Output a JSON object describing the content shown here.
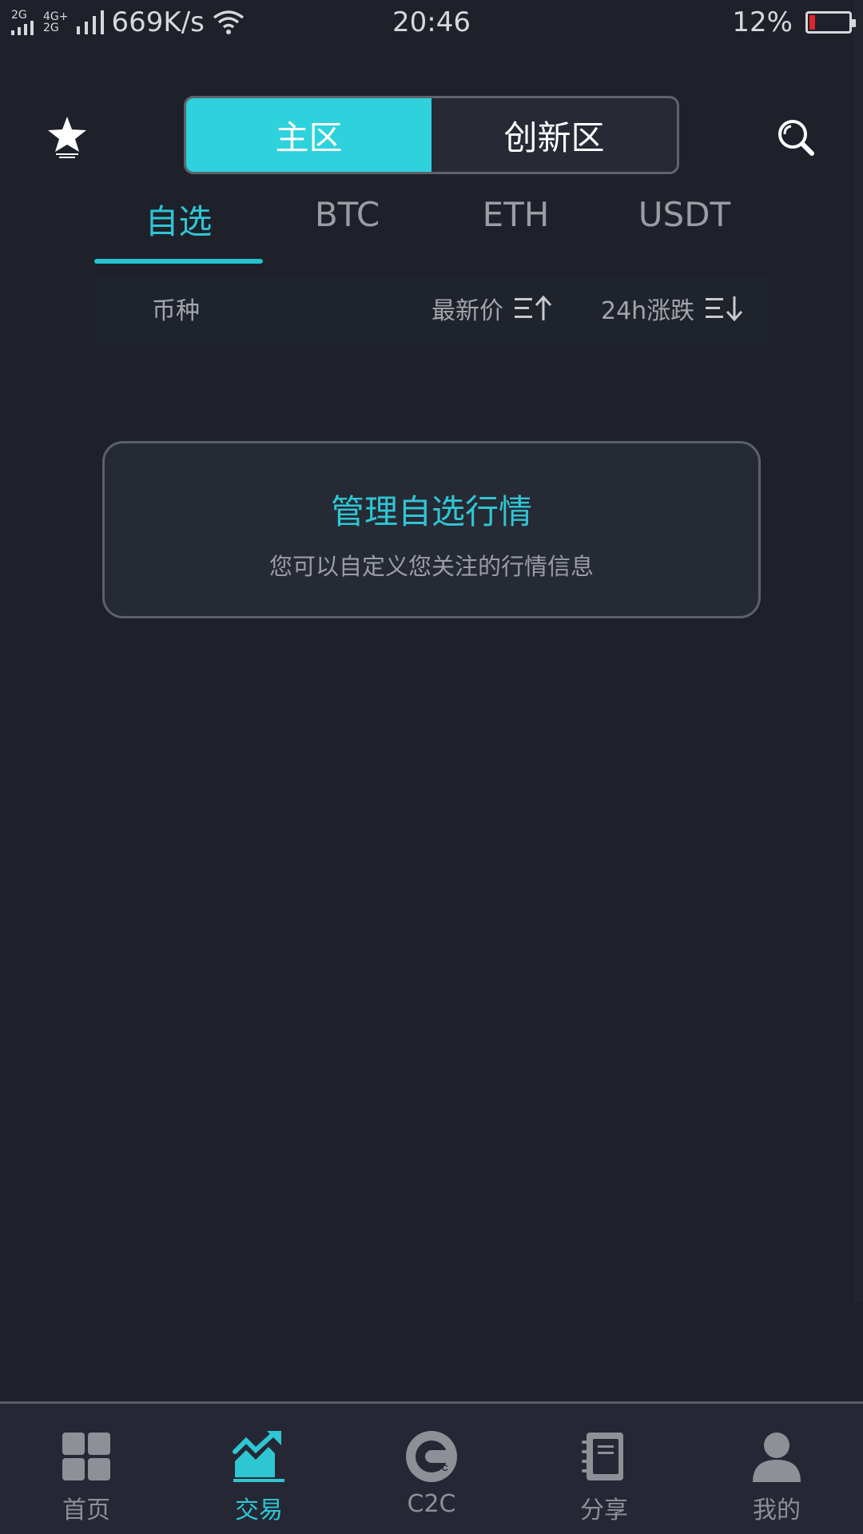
{
  "status_bar": {
    "signal_1": "2G",
    "signal_2a": "4G+",
    "signal_2b": "2G",
    "net_speed": "669K/s",
    "time": "20:46",
    "battery_text": "12%",
    "battery_level": 0.12
  },
  "header": {
    "segments": [
      {
        "label": "主区",
        "active": true
      },
      {
        "label": "创新区",
        "active": false
      }
    ]
  },
  "tabs": [
    {
      "label": "自选",
      "active": true
    },
    {
      "label": "BTC",
      "active": false
    },
    {
      "label": "ETH",
      "active": false
    },
    {
      "label": "USDT",
      "active": false
    }
  ],
  "columns": {
    "coin": "币种",
    "price": "最新价",
    "change": "24h涨跌"
  },
  "empty_card": {
    "title": "管理自选行情",
    "subtitle": "您可以自定义您关注的行情信息"
  },
  "bottom_nav": [
    {
      "label": "首页",
      "icon": "home-grid-icon",
      "active": false
    },
    {
      "label": "交易",
      "icon": "trade-chart-icon",
      "active": true
    },
    {
      "label": "C2C",
      "icon": "c2c-icon",
      "active": false
    },
    {
      "label": "分享",
      "icon": "notebook-icon",
      "active": false
    },
    {
      "label": "我的",
      "icon": "user-icon",
      "active": false
    }
  ],
  "colors": {
    "accent": "#2dd2dc",
    "background": "#1e212a",
    "battery_low": "#e0262b"
  }
}
